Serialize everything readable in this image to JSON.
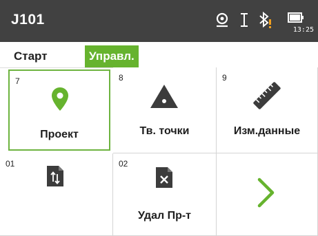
{
  "header": {
    "title": "J101",
    "time": "13:25",
    "icons": [
      "target-icon",
      "cursor-icon",
      "bluetooth-warning-icon",
      "battery-icon"
    ]
  },
  "tabs": [
    {
      "label": "Старт",
      "active": false
    },
    {
      "label": "Управл.",
      "active": true
    }
  ],
  "tiles": [
    {
      "number": "7",
      "label": "Проект",
      "icon": "location-pin-icon",
      "selected": true
    },
    {
      "number": "8",
      "label": "Тв. точки",
      "icon": "triangle-icon",
      "selected": false
    },
    {
      "number": "9",
      "label": "Изм.данные",
      "icon": "ruler-icon",
      "selected": false
    },
    {
      "number": "01",
      "label": "",
      "icon": "file-transfer-icon",
      "selected": false
    },
    {
      "number": "02",
      "label": "Удал Пр-т",
      "icon": "file-delete-icon",
      "selected": false
    },
    {
      "number": "",
      "label": "",
      "icon": "chevron-right-icon",
      "selected": false
    }
  ],
  "colors": {
    "accent": "#66b32e",
    "header_bg": "#414141",
    "icon_dark": "#3c3c3c"
  }
}
